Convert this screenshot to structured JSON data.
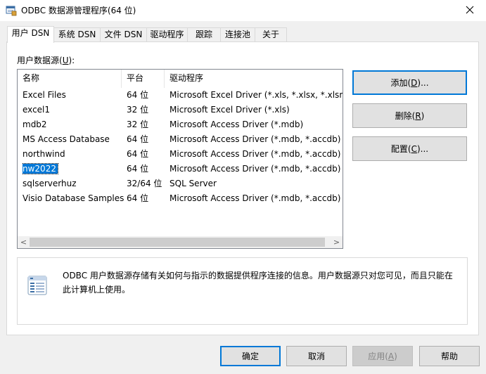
{
  "window": {
    "title": "ODBC 数据源管理程序(64 位)",
    "icon": "odbc-app-icon",
    "close_icon": "close-icon"
  },
  "tabs": [
    {
      "label": "用户 DSN",
      "active": true
    },
    {
      "label": "系统 DSN",
      "active": false
    },
    {
      "label": "文件 DSN",
      "active": false
    },
    {
      "label": "驱动程序",
      "active": false
    },
    {
      "label": "跟踪",
      "active": false
    },
    {
      "label": "连接池",
      "active": false
    },
    {
      "label": "关于",
      "active": false
    }
  ],
  "user_dsn": {
    "list_label_prefix": "用户数据源(",
    "list_label_accel": "U",
    "list_label_suffix": "):",
    "columns": [
      "名称",
      "平台",
      "驱动程序"
    ],
    "rows": [
      {
        "name": "Excel Files",
        "platform": "64 位",
        "driver": "Microsoft Excel Driver (*.xls, *.xlsx, *.xlsm, *"
      },
      {
        "name": "excel1",
        "platform": "32 位",
        "driver": "Microsoft Excel Driver (*.xls)"
      },
      {
        "name": "mdb2",
        "platform": "32 位",
        "driver": "Microsoft Access Driver (*.mdb)"
      },
      {
        "name": "MS Access Database",
        "platform": "64 位",
        "driver": "Microsoft Access Driver (*.mdb, *.accdb)"
      },
      {
        "name": "northwind",
        "platform": "64 位",
        "driver": "Microsoft Access Driver (*.mdb, *.accdb)"
      },
      {
        "name": "nw2022",
        "platform": "64 位",
        "driver": "Microsoft Access Driver (*.mdb, *.accdb)",
        "selected": true
      },
      {
        "name": "sqlserverhuz",
        "platform": "32/64 位",
        "driver": "SQL Server"
      },
      {
        "name": "Visio Database Samples",
        "platform": "64 位",
        "driver": "Microsoft Access Driver (*.mdb, *.accdb)"
      }
    ],
    "scroll_left": "<",
    "scroll_right": ">",
    "buttons": {
      "add": {
        "prefix": "添加(",
        "accel": "D",
        "suffix": ")..."
      },
      "remove": {
        "prefix": "删除(",
        "accel": "R",
        "suffix": ")"
      },
      "configure": {
        "prefix": "配置(",
        "accel": "C",
        "suffix": ")..."
      }
    },
    "info_text": "ODBC 用户数据源存储有关如何与指示的数据提供程序连接的信息。用户数据源只对您可见，而且只能在此计算机上使用。",
    "info_icon": "data-source-icon"
  },
  "footer": {
    "ok": "确定",
    "cancel": "取消",
    "apply_prefix": "应用(",
    "apply_accel": "A",
    "apply_suffix": ")",
    "help": "帮助"
  },
  "colors": {
    "accent": "#0078d7",
    "selection": "#0078d7"
  }
}
